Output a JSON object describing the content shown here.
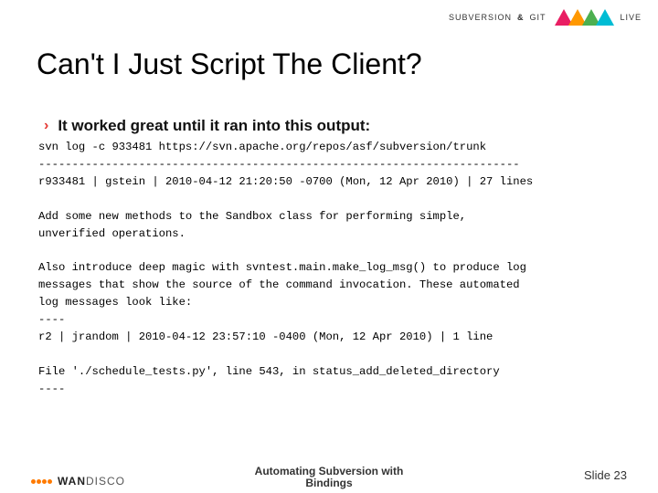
{
  "brand": {
    "left": "SUBVERSION",
    "amp": "&",
    "right": "GIT",
    "live": "LIVE"
  },
  "title": "Can't I Just Script The Client?",
  "bullet": "It worked great until it ran into this output:",
  "code": "svn log -c 933481 https://svn.apache.org/repos/asf/subversion/trunk\n------------------------------------------------------------------------\nr933481 | gstein | 2010-04-12 21:20:50 -0700 (Mon, 12 Apr 2010) | 27 lines\n\nAdd some new methods to the Sandbox class for performing simple,\nunverified operations.\n\nAlso introduce deep magic with svntest.main.make_log_msg() to produce log\nmessages that show the source of the command invocation. These automated\nlog messages look like:\n----\nr2 | jrandom | 2010-04-12 23:57:10 -0400 (Mon, 12 Apr 2010) | 1 line\n\nFile './schedule_tests.py', line 543, in status_add_deleted_directory\n----",
  "footer": {
    "logo": "WANDISCO",
    "center1": "Automating Subversion with",
    "center2": "Bindings",
    "slide": "Slide 23"
  }
}
